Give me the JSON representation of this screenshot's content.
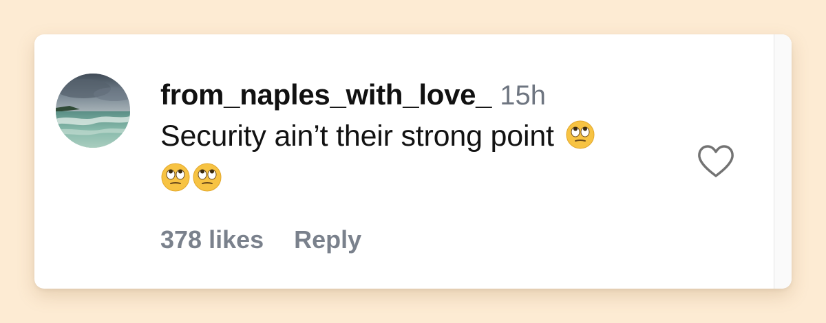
{
  "comment": {
    "username": "from_naples_with_love_",
    "timestamp": "15h",
    "text": "Security ain’t their strong point",
    "emojis_inline": [
      "face-with-rolling-eyes"
    ],
    "emojis_second_line": [
      "face-with-rolling-eyes",
      "face-with-rolling-eyes"
    ],
    "likes": "378 likes",
    "reply_label": "Reply"
  },
  "icons": {
    "avatar": "beach-photo-avatar",
    "like": "heart-outline-icon",
    "emoji": "rolling-eyes-emoji"
  },
  "colors": {
    "background": "#fdebd3",
    "card": "#ffffff",
    "muted_text": "#7a818c",
    "primary_text": "#111111"
  }
}
